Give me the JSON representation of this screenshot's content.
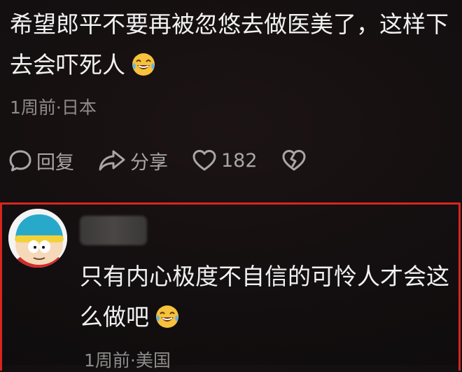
{
  "comment": {
    "text": "希望郎平不要再被忽悠去做医美了，这样下去会吓死人",
    "emoji": "laughing-crying-emoji",
    "meta": "1周前·日本",
    "actions": {
      "reply_label": "回复",
      "share_label": "分享",
      "like_count": "182"
    }
  },
  "reply": {
    "text": "只有内心极度不自信的可怜人才会这么做吧",
    "emoji": "laughing-crying-emoji",
    "meta": "1周前·美国"
  },
  "colors": {
    "highlight_border": "#d7261f",
    "text_primary": "#f1f1f1",
    "text_secondary": "#8f8c8c",
    "background": "#140f10"
  }
}
